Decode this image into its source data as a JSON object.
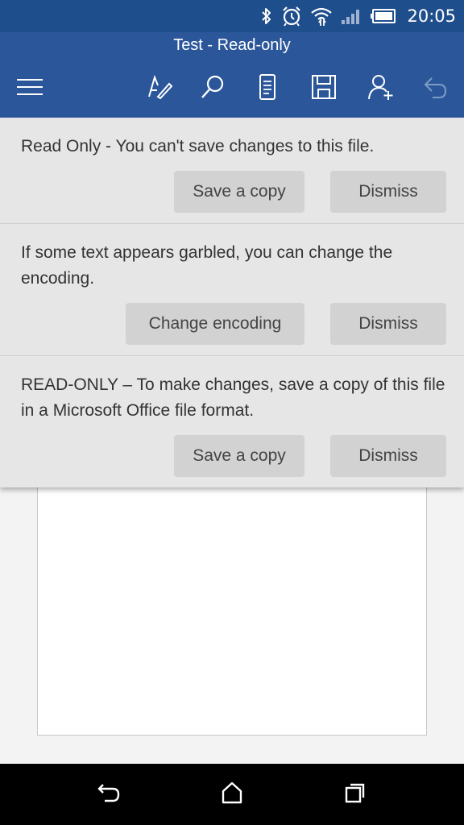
{
  "status_bar": {
    "time": "20:05",
    "icons": [
      "bluetooth-icon",
      "alarm-icon",
      "wifi-icon",
      "signal-icon",
      "battery-icon"
    ]
  },
  "app_bar": {
    "title": "Test - Read-only",
    "toolbar": [
      "menu-icon",
      "edit-icon",
      "search-icon",
      "mobile-view-icon",
      "save-icon",
      "share-icon",
      "undo-icon"
    ]
  },
  "notices": [
    {
      "text": "Read Only - You can't save changes to this file.",
      "primary": "Save a copy",
      "dismiss": "Dismiss"
    },
    {
      "text": "If some text appears garbled, you can change the encoding.",
      "primary": "Change encoding",
      "dismiss": "Dismiss"
    },
    {
      "text": "READ-ONLY – To make changes, save a copy of this file in a Microsoft Office file format.",
      "primary": "Save a copy",
      "dismiss": "Dismiss"
    }
  ],
  "nav_bar": [
    "back-icon",
    "home-icon",
    "recents-icon"
  ],
  "colors": {
    "status_bar": "#1f4e8c",
    "app_bar": "#2b579a",
    "panel": "#e6e6e6",
    "button": "#d2d2d2"
  }
}
